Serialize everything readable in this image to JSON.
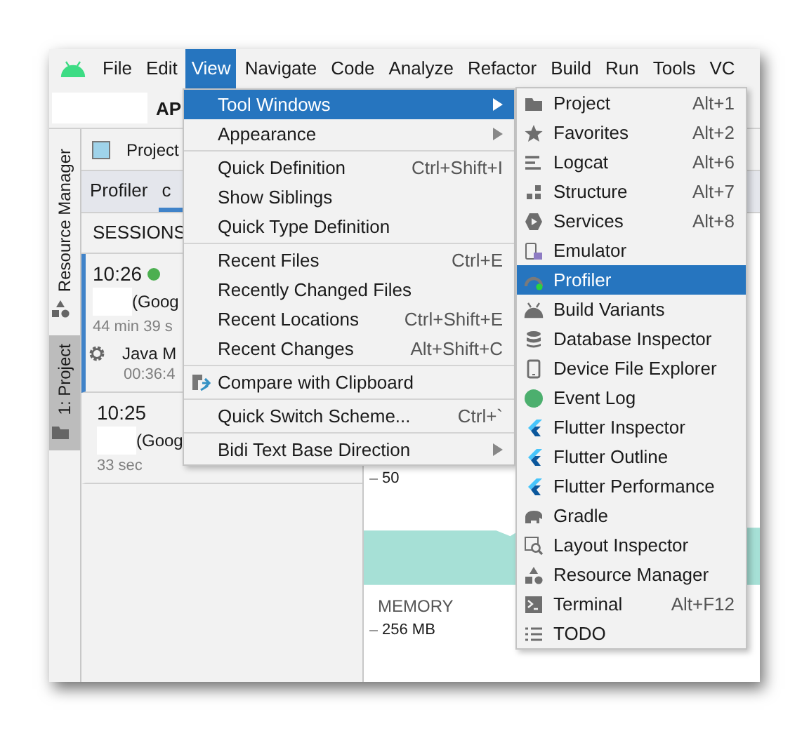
{
  "menu_bar": {
    "items": [
      {
        "label": "File",
        "selected": false
      },
      {
        "label": "Edit",
        "selected": false
      },
      {
        "label": "View",
        "selected": true
      },
      {
        "label": "Navigate",
        "selected": false
      },
      {
        "label": "Code",
        "selected": false
      },
      {
        "label": "Analyze",
        "selected": false
      },
      {
        "label": "Refactor",
        "selected": false
      },
      {
        "label": "Build",
        "selected": false
      },
      {
        "label": "Run",
        "selected": false
      },
      {
        "label": "Tools",
        "selected": false
      },
      {
        "label": "VC",
        "selected": false
      }
    ]
  },
  "toolbar": {
    "title": "AP"
  },
  "side_tabs": [
    {
      "label": "Resource Manager",
      "selected": false
    },
    {
      "label": "1: Project",
      "selected": true
    }
  ],
  "project_panel": {
    "title": "Project"
  },
  "profiler_tabs": [
    {
      "label": "Profiler",
      "selected": false
    },
    {
      "label": "c",
      "selected": true
    }
  ],
  "sessions": {
    "header": "SESSIONS",
    "items": [
      {
        "time": "10:26",
        "live": true,
        "device": "(Goog",
        "duration": "44 min 39 s",
        "selected": true,
        "processes": [
          {
            "name": "Java M",
            "time": "00:36:4"
          }
        ]
      },
      {
        "time": "10:25",
        "live": false,
        "device": "(Goog",
        "duration": "33 sec",
        "selected": false
      }
    ]
  },
  "monitor": {
    "tick": "50",
    "memory_label": "MEMORY",
    "memory_tick": "256 MB"
  },
  "view_menu": {
    "groups": [
      [
        {
          "label": "Tool Windows",
          "submenu": true,
          "selected": true,
          "kind": "plain"
        },
        {
          "label": "Appearance",
          "submenu": true,
          "selected": false,
          "kind": "plain"
        }
      ],
      [
        {
          "label": "Quick Definition",
          "shortcut": "Ctrl+Shift+I",
          "submenu": false,
          "selected": false,
          "kind": "plain"
        },
        {
          "label": "Show Siblings",
          "submenu": false,
          "selected": false,
          "kind": "plain"
        },
        {
          "label": "Quick Type Definition",
          "submenu": false,
          "selected": false,
          "kind": "plain"
        }
      ],
      [
        {
          "label": "Recent Files",
          "shortcut": "Ctrl+E",
          "submenu": false,
          "selected": false,
          "kind": "plain"
        },
        {
          "label": "Recently Changed Files",
          "submenu": false,
          "selected": false,
          "kind": "plain"
        },
        {
          "label": "Recent Locations",
          "shortcut": "Ctrl+Shift+E",
          "submenu": false,
          "selected": false,
          "kind": "plain"
        },
        {
          "label": "Recent Changes",
          "shortcut": "Alt+Shift+C",
          "submenu": false,
          "selected": false,
          "kind": "plain"
        }
      ],
      [
        {
          "label": "Compare with Clipboard",
          "submenu": false,
          "selected": false,
          "kind": "compare"
        }
      ],
      [
        {
          "label": "Quick Switch Scheme...",
          "shortcut": "Ctrl+`",
          "submenu": false,
          "selected": false,
          "kind": "plain"
        }
      ],
      [
        {
          "label": "Bidi Text Base Direction",
          "submenu": true,
          "selected": false,
          "kind": "plain"
        }
      ]
    ]
  },
  "tool_windows_menu": {
    "items": [
      {
        "label": "Project",
        "shortcut": "Alt+1",
        "selected": false,
        "kind": "folder"
      },
      {
        "label": "Favorites",
        "shortcut": "Alt+2",
        "selected": false,
        "kind": "star"
      },
      {
        "label": "Logcat",
        "shortcut": "Alt+6",
        "selected": false,
        "kind": "lines"
      },
      {
        "label": "Structure",
        "shortcut": "Alt+7",
        "selected": false,
        "kind": "structure"
      },
      {
        "label": "Services",
        "shortcut": "Alt+8",
        "selected": false,
        "kind": "services"
      },
      {
        "label": "Emulator",
        "selected": false,
        "kind": "emulator"
      },
      {
        "label": "Profiler",
        "selected": true,
        "kind": "gauge"
      },
      {
        "label": "Build Variants",
        "selected": false,
        "kind": "android"
      },
      {
        "label": "Database Inspector",
        "selected": false,
        "kind": "database"
      },
      {
        "label": "Device File Explorer",
        "selected": false,
        "kind": "phone"
      },
      {
        "label": "Event Log",
        "selected": false,
        "kind": "bubble"
      },
      {
        "label": "Flutter Inspector",
        "selected": false,
        "kind": "flutter"
      },
      {
        "label": "Flutter Outline",
        "selected": false,
        "kind": "flutter"
      },
      {
        "label": "Flutter Performance",
        "selected": false,
        "kind": "flutter"
      },
      {
        "label": "Gradle",
        "selected": false,
        "kind": "elephant"
      },
      {
        "label": "Layout Inspector",
        "selected": false,
        "kind": "layout"
      },
      {
        "label": "Resource Manager",
        "selected": false,
        "kind": "shapes"
      },
      {
        "label": "Terminal",
        "shortcut": "Alt+F12",
        "selected": false,
        "kind": "terminal"
      },
      {
        "label": "TODO",
        "selected": false,
        "kind": "list"
      }
    ]
  }
}
